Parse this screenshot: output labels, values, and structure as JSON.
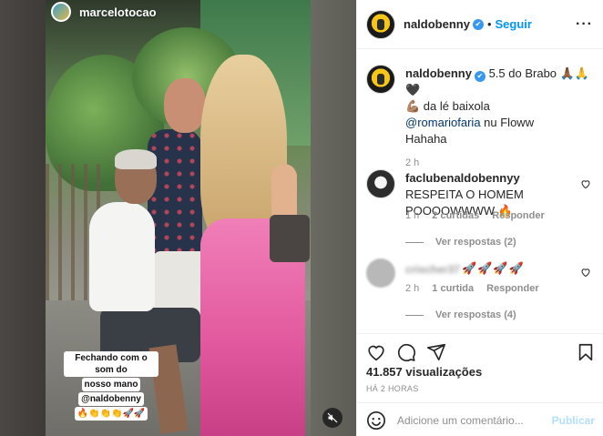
{
  "story": {
    "username": "marcelotocao",
    "sticker_lines": [
      "Fechando com o som do",
      "nosso mano",
      "@naldobenny",
      "🔥👏👏👏🚀🚀"
    ]
  },
  "post": {
    "author": "naldobenny",
    "follow_label": "Seguir",
    "caption": {
      "username": "naldobenny",
      "line1": "5.5 do Brabo 🙏🏾🙏🖤",
      "line2": "💪🏽 da lé baixola",
      "mention": "@romariofaria",
      "line3_rest": " nu Floww",
      "line4": "Hahaha",
      "time": "2 h"
    },
    "comments": [
      {
        "username": "faclubenaldobennyy",
        "text": "RESPEITA O HOMEM POOOOWWWW 🔥",
        "time": "1 h",
        "likes": "2 curtidas",
        "reply_label": "Responder",
        "view_replies": "Ver respostas (2)"
      },
      {
        "username": "crischer37",
        "text": "🚀🚀🚀🚀",
        "time": "2 h",
        "likes": "1 curtida",
        "reply_label": "Responder",
        "view_replies": "Ver respostas (4)"
      }
    ],
    "views": "41.857 visualizações",
    "posted": "HÁ 2 HORAS",
    "comment_placeholder": "Adicione um comentário...",
    "publish_label": "Publicar"
  },
  "icons": {
    "like": "heart-icon",
    "comment": "comment-icon",
    "share": "share-icon",
    "save": "bookmark-icon",
    "emoji": "emoji-icon",
    "mute": "muted-speaker-icon",
    "more": "more-options-icon",
    "verified": "verified-badge-icon"
  },
  "colors": {
    "accent": "#0095f6",
    "verified": "#3897f0",
    "muted_text": "#8e8e8e",
    "publish_disabled": "#b2dffc"
  }
}
